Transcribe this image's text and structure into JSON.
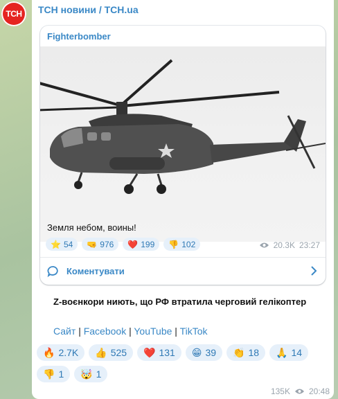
{
  "channel": {
    "name": "ТСН новини / TCH.ua",
    "avatar_text": "TCH",
    "brand_color": "#e52421"
  },
  "forwarded": {
    "sender": "Fighterbomber",
    "caption": "Земля небом, воины!",
    "reactions": [
      {
        "icon": "star-icon",
        "emoji": "⭐",
        "count": "54"
      },
      {
        "icon": "fist-icon",
        "emoji": "🤜",
        "count": "976"
      },
      {
        "icon": "heart-icon",
        "emoji": "❤️",
        "count": "199"
      },
      {
        "icon": "thumbs-down-icon",
        "emoji": "👎",
        "count": "102"
      }
    ],
    "views": "20.3K",
    "time": "23:27",
    "comments_label": "Коментувати"
  },
  "post": {
    "text": "Z-воєнкори ниють, що РФ втратила черговий гелікоптер",
    "links": [
      "Сайт",
      "Facebook",
      "YouTube",
      "TikTok"
    ],
    "reactions_row1": [
      {
        "icon": "fire-icon",
        "emoji": "🔥",
        "count": "2.7K"
      },
      {
        "icon": "thumbs-up-icon",
        "emoji": "👍",
        "count": "525"
      },
      {
        "icon": "heart-icon",
        "emoji": "❤️",
        "count": "131"
      },
      {
        "icon": "grin-icon",
        "emoji": "😁",
        "count": "39"
      },
      {
        "icon": "clap-icon",
        "emoji": "👏",
        "count": "18"
      },
      {
        "icon": "pray-icon",
        "emoji": "🙏",
        "count": "14"
      }
    ],
    "reactions_row2": [
      {
        "icon": "thumbs-down-icon",
        "emoji": "👎",
        "count": "1"
      },
      {
        "icon": "mind-blown-icon",
        "emoji": "🤯",
        "count": "1"
      }
    ],
    "views": "135K",
    "time": "20:48"
  }
}
